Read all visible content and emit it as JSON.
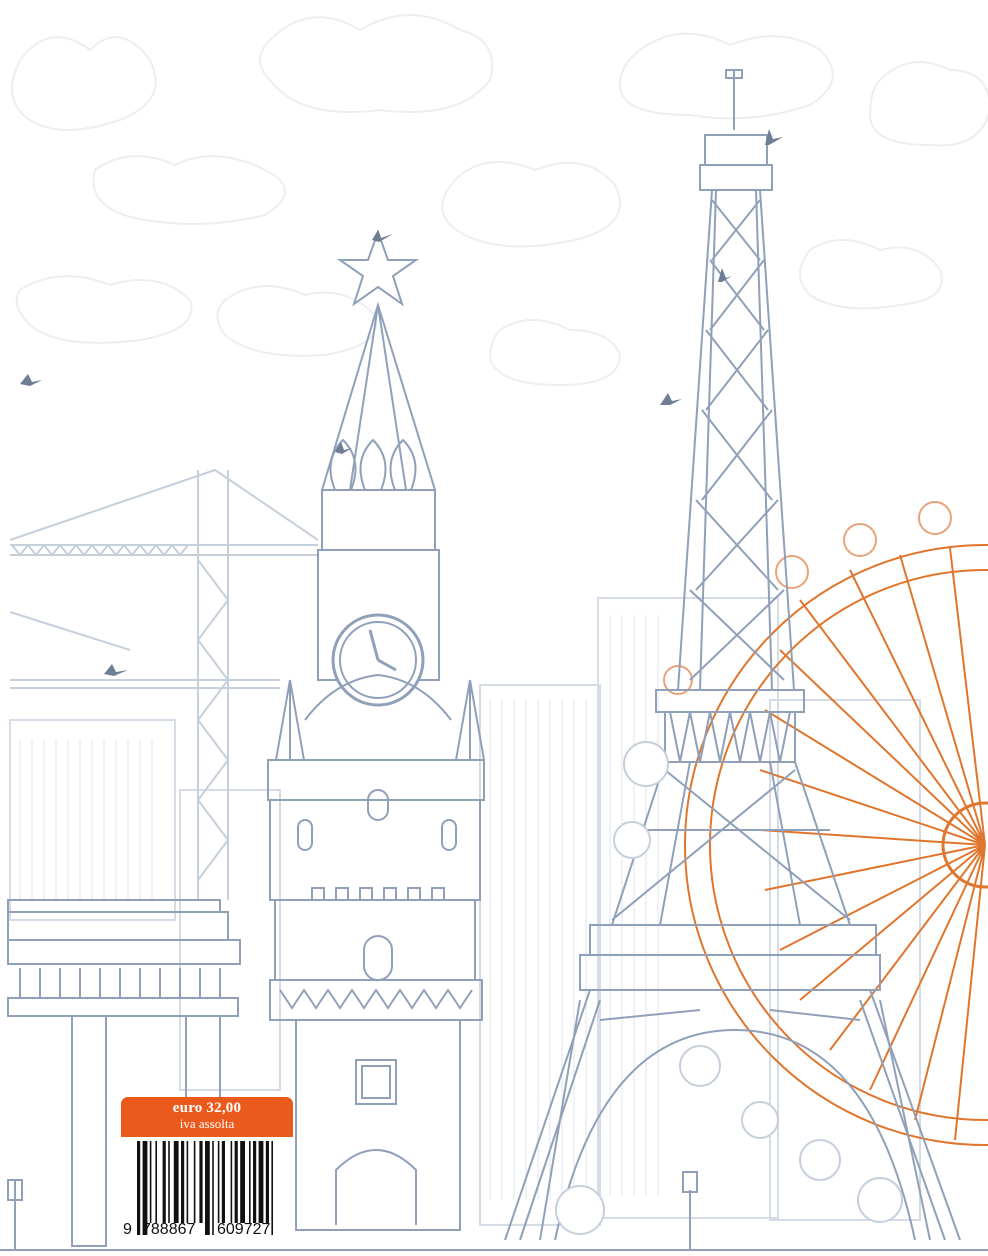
{
  "price": {
    "amount": "euro 32,00",
    "tax_note": "iva assolta"
  },
  "barcode": {
    "lead_digit": "9",
    "left_group": "788867",
    "right_group": "609727"
  },
  "colors": {
    "line_blue": "#8fa0b8",
    "line_light": "#d3dbe6",
    "accent_orange": "#ea5a1c",
    "wheel_orange": "#e0762e",
    "cloud": "#eef0f3"
  },
  "scene": {
    "landmarks": [
      "kremlin-spasskaya-tower",
      "eiffel-tower",
      "ferris-wheel",
      "construction-cranes",
      "office-buildings",
      "classical-building",
      "street-lamps",
      "trees"
    ],
    "birds": 6
  }
}
